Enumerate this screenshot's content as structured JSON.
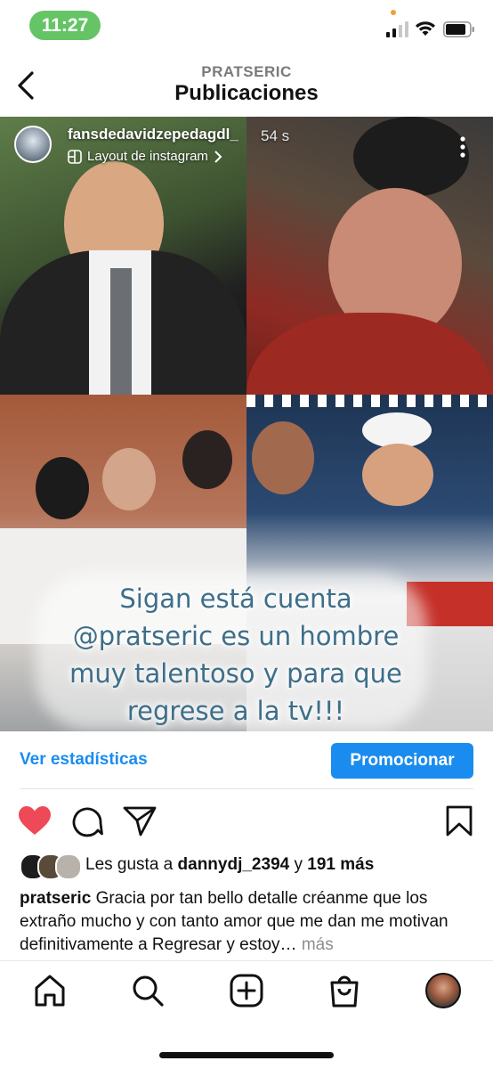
{
  "status_bar": {
    "time": "11:27",
    "accent_color": "#65c466"
  },
  "header": {
    "username": "PRATSERIC",
    "title": "Publicaciones"
  },
  "post": {
    "author": "fansdedavidzepedagdl_",
    "time_ago": "54 s",
    "layout_label": "Layout de instagram",
    "overlay_lines": [
      "Sigan está cuenta",
      "@pratseric es un hombre",
      "muy talentoso y para que",
      "regrese a la tv!!!"
    ]
  },
  "actions": {
    "stats_label": "Ver estadísticas",
    "promote_label": "Promocionar",
    "link_color": "#1a8cf0",
    "like_color": "#ed4956"
  },
  "likes": {
    "prefix": "Les gusta a",
    "user": "dannydj_2394",
    "connector": "y",
    "others": "191 más"
  },
  "caption": {
    "user": "pratseric",
    "text": "Gracia por tan bello detalle créanme que los extraño mucho y con tanto amor que me dan me motivan definitivamente a Regresar y estoy…",
    "more_label": "más"
  },
  "nav": {
    "icons": [
      "home-icon",
      "search-icon",
      "create-icon",
      "shop-icon",
      "profile-avatar"
    ]
  }
}
